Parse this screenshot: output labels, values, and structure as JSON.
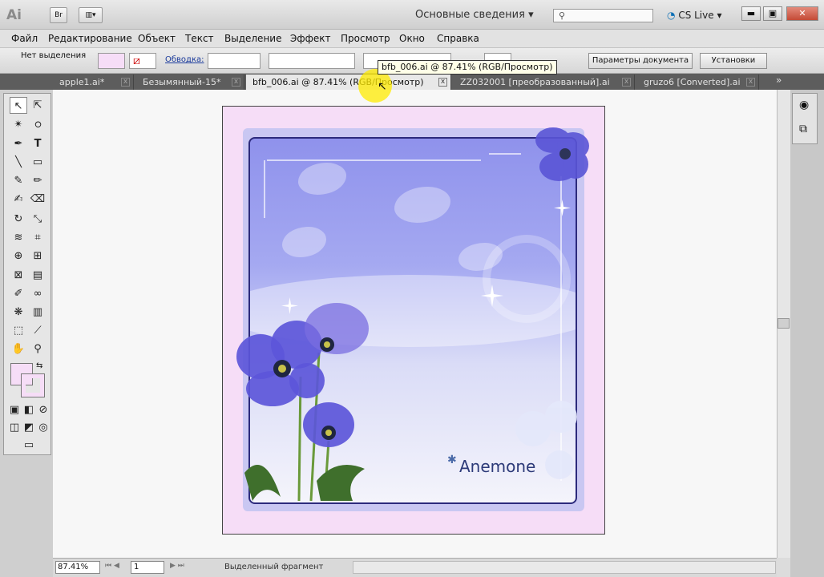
{
  "app": {
    "logo": "Ai",
    "bridge_label": "Br"
  },
  "titlebar": {
    "workspace": "Основные сведения",
    "search_placeholder": "",
    "cs_live": "CS Live"
  },
  "menu": [
    "Файл",
    "Редактирование",
    "Объект",
    "Текст",
    "Выделение",
    "Эффект",
    "Просмотр",
    "Окно",
    "Справка"
  ],
  "control": {
    "selection_label": "Нет выделения",
    "stroke_label": "Обводка:",
    "doc_settings_button": "Параметры документа",
    "preferences_button": "Установки"
  },
  "tabs": [
    {
      "label": "apple1.ai*",
      "active": false
    },
    {
      "label": "Безымянный-15*",
      "active": false
    },
    {
      "label": "bfb_006.ai @ 87.41% (RGB/Просмотр)",
      "active": true
    },
    {
      "label": "ZZ032001 [преобразованный].ai",
      "active": false
    },
    {
      "label": "gruzo6 [Converted].ai",
      "active": false
    }
  ],
  "tooltip": "bfb_006.ai @ 87.41% (RGB/Просмотр)",
  "artwork": {
    "caption": "Anemone"
  },
  "status": {
    "zoom": "87.41%",
    "page": "1",
    "text": "Выделенный фрагмент"
  },
  "colors": {
    "artboard_bg": "#f6ddf7",
    "frame_border": "#2c2a7c",
    "tab_bar": "#5d5d5d",
    "flower": "#5a55d6"
  }
}
